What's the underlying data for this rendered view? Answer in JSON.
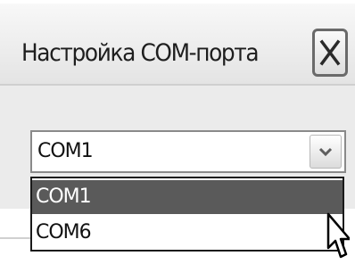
{
  "window": {
    "title": "Настройка COM-порта"
  },
  "port_select": {
    "selected_value": "COM1",
    "options": [
      "COM1",
      "COM6"
    ],
    "highlighted_option": "COM1"
  },
  "icons": {
    "close": "close-icon",
    "dropdown_arrow": "chevron-down-icon",
    "pointer": "mouse-cursor-icon"
  },
  "colors": {
    "highlight_bg": "#5a5a5a",
    "title_text": "#1e1e1e",
    "body_bg": "#ebebeb"
  }
}
